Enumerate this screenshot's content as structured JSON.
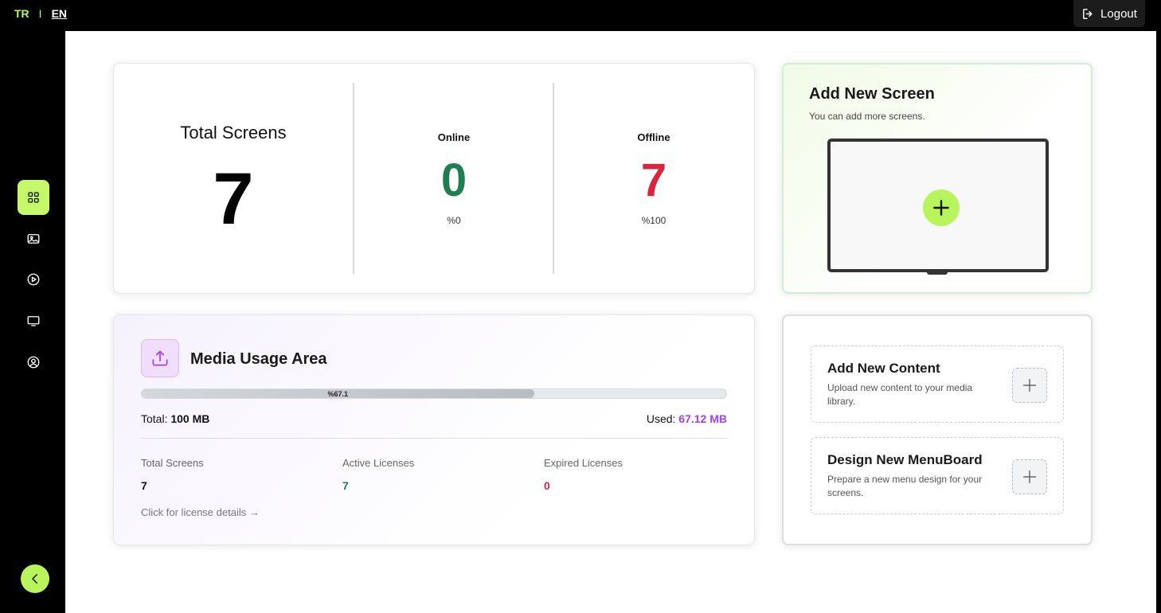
{
  "topbar": {
    "lang_tr": "TR",
    "lang_sep": "I",
    "lang_en": "EN",
    "logout_label": "Logout"
  },
  "sidebar": {
    "items": [
      {
        "icon": "dashboard-grid-icon",
        "active": true
      },
      {
        "icon": "media-gallery-icon",
        "active": false
      },
      {
        "icon": "play-circle-icon",
        "active": false
      },
      {
        "icon": "monitor-icon",
        "active": false
      },
      {
        "icon": "user-profile-icon",
        "active": false
      }
    ],
    "collapse_icon": "chevron-left-icon"
  },
  "stats": {
    "total_label": "Total Screens",
    "total_value": "7",
    "online_label": "Online",
    "online_value": "0",
    "online_pct": "%0",
    "offline_label": "Offline",
    "offline_value": "7",
    "offline_pct": "%100"
  },
  "add_screen": {
    "title": "Add New Screen",
    "subtitle": "You can add more screens."
  },
  "media_usage": {
    "title": "Media Usage Area",
    "progress_label": "%67.1",
    "progress_fraction": 0.671,
    "total_label": "Total:",
    "total_value": "100 MB",
    "used_label": "Used:",
    "used_value": "67.12 MB",
    "licenses": [
      {
        "label": "Total Screens",
        "value": "7"
      },
      {
        "label": "Active Licenses",
        "value": "7"
      },
      {
        "label": "Expired Licenses",
        "value": "0"
      }
    ],
    "license_link": "Click for license details →"
  },
  "actions": {
    "items": [
      {
        "title": "Add New Content",
        "desc": "Upload new content to your media library."
      },
      {
        "title": "Design New MenuBoard",
        "desc": "Prepare a new menu design for your screens."
      }
    ]
  },
  "colors": {
    "accent": "#b8f55c",
    "online": "#1e7e4f",
    "offline": "#d7263d",
    "used": "#a440ec"
  }
}
